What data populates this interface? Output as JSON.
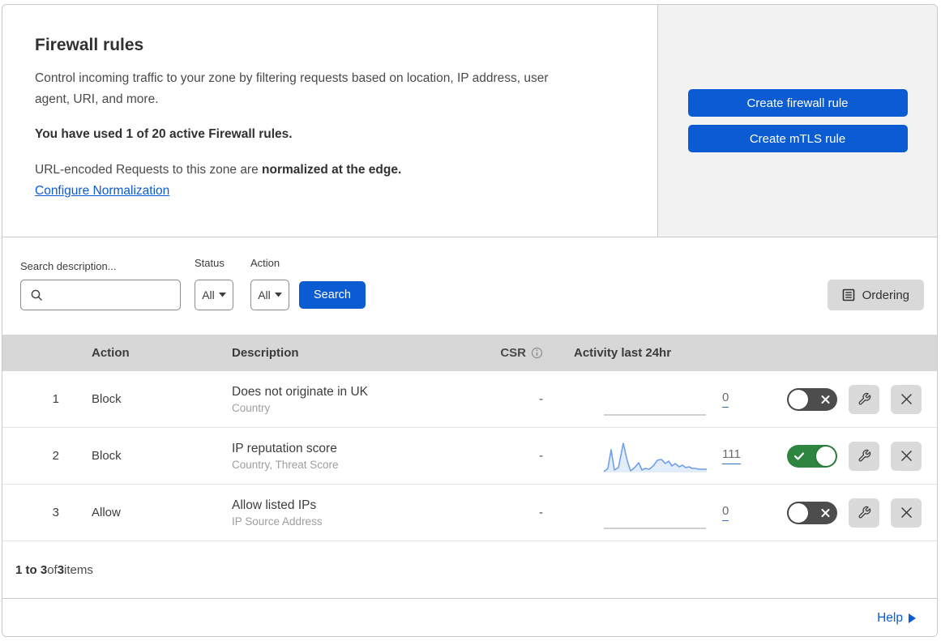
{
  "header": {
    "title": "Firewall rules",
    "description": "Control incoming traffic to your zone by filtering requests based on location, IP address, user agent, URI, and more.",
    "usage": "You have used 1 of 20 active Firewall rules.",
    "norm_prefix": "URL-encoded Requests to this zone are ",
    "norm_bold": "normalized at the edge.",
    "norm_link": "Configure Normalization",
    "create_firewall_button": "Create firewall rule",
    "create_mtls_button": "Create mTLS rule"
  },
  "filters": {
    "search_label": "Search description...",
    "search_value": "",
    "status_label": "Status",
    "status_value": "All",
    "action_label": "Action",
    "action_value": "All",
    "search_button": "Search",
    "ordering_button": "Ordering"
  },
  "table": {
    "headers": {
      "action": "Action",
      "description": "Description",
      "csr": "CSR",
      "activity": "Activity last 24hr"
    },
    "rows": [
      {
        "index": "1",
        "action": "Block",
        "description": "Does not originate in UK",
        "fields": "Country",
        "csr": "-",
        "count": "0",
        "enabled": false,
        "sparkline_line": "2,40 128,40",
        "sparkline_fill": ""
      },
      {
        "index": "2",
        "action": "Block",
        "description": "IP reputation score",
        "fields": "Country, Threat Score",
        "csr": "-",
        "count": "111",
        "enabled": true,
        "sparkline_line": "2,40 7,36 11,13 15,38 20,35 26,5 31,27 35,39 40,35 45,29 49,38 53,36 58,37 63,33 68,26 73,25 78,30 82,27 86,33 90,30 95,34 99,32 103,35 107,34 111,36 115,36 119,37 123,37 129,37",
        "sparkline_fill": "2,41 2,40 7,36 11,13 15,38 20,35 26,5 31,27 35,39 40,35 45,29 49,38 53,36 58,37 63,33 68,26 73,25 78,30 82,27 86,33 90,30 95,34 99,32 103,35 107,34 111,36 115,36 119,37 123,37 129,37 129,41"
      },
      {
        "index": "3",
        "action": "Allow",
        "description": "Allow listed IPs",
        "fields": "IP Source Address",
        "csr": "-",
        "count": "0",
        "enabled": false,
        "sparkline_line": "2,40 128,40",
        "sparkline_fill": ""
      }
    ]
  },
  "footer": {
    "range": "1 to 3",
    "of": " of ",
    "total": "3",
    "items": " items",
    "help": "Help"
  },
  "colors": {
    "accent_blue": "#0b5bd3",
    "toggle_on_green": "#2e8540",
    "toggle_off_gray": "#4d4d4d",
    "sparkline_blue": "#6f9fe8",
    "table_header_gray": "#d7d7d7",
    "panel_gray": "#f2f2f2"
  }
}
